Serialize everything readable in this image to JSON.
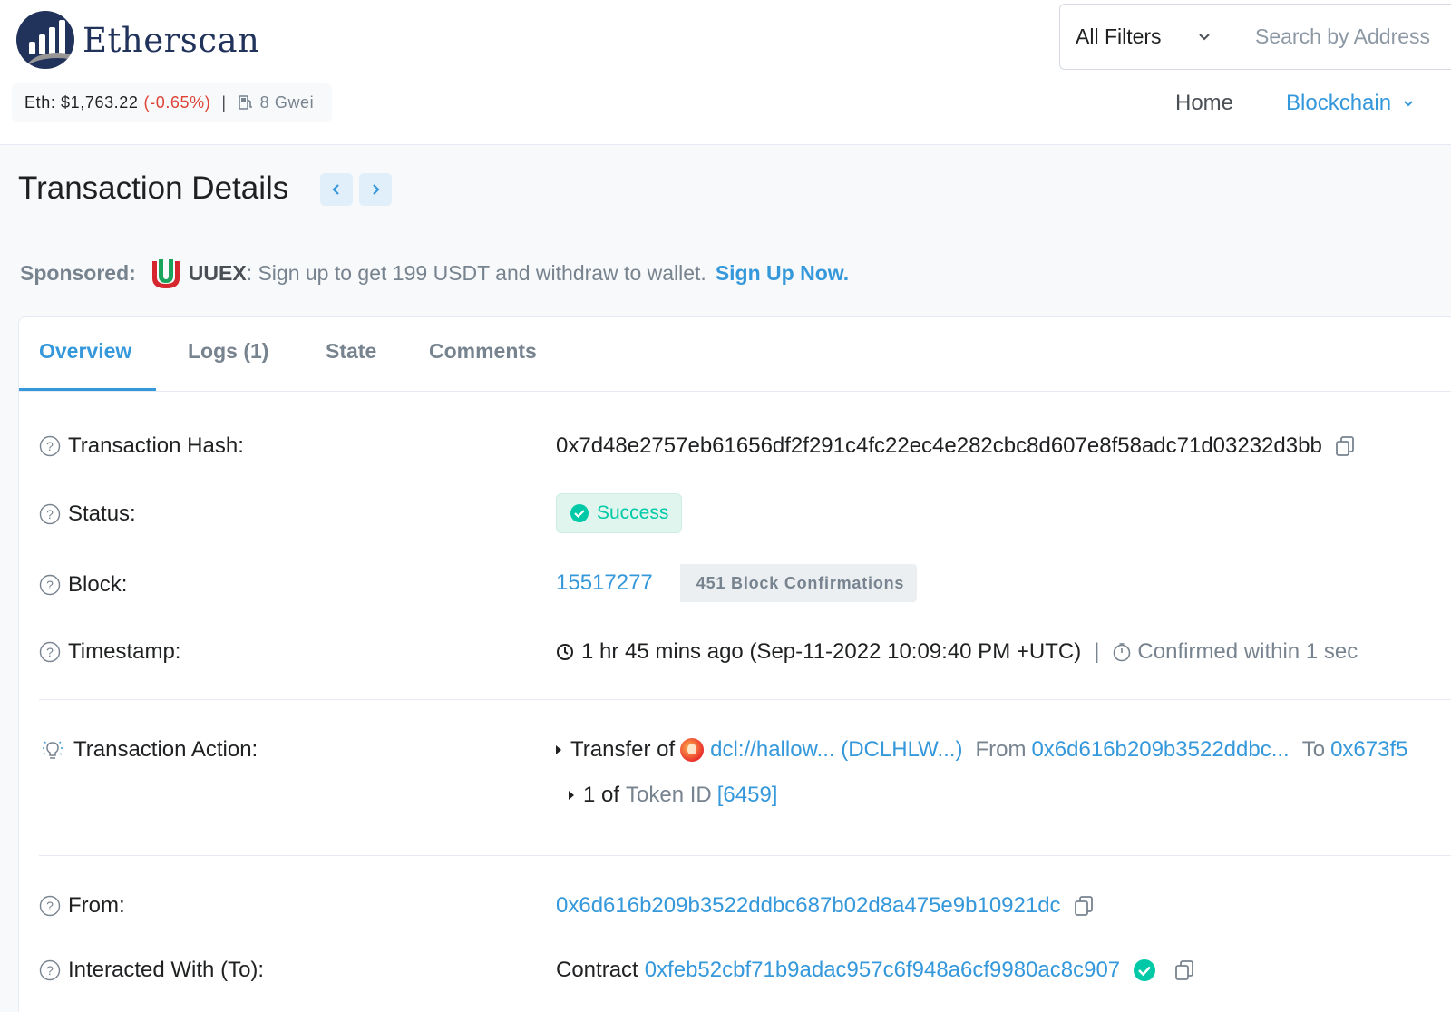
{
  "header": {
    "logo_text": "Etherscan",
    "eth_label": "Eth:",
    "eth_price": "$1,763.22",
    "eth_change": "(-0.65%)",
    "separator": "|",
    "gas": "8 Gwei",
    "filter_label": "All Filters",
    "search_placeholder": "Search by Address",
    "nav_home": "Home",
    "nav_blockchain": "Blockchain"
  },
  "page": {
    "title": "Transaction Details"
  },
  "sponsored": {
    "label": "Sponsored:",
    "brand": "UUEX",
    "message": ": Sign up to get 199 USDT and withdraw to wallet.",
    "cta": "Sign Up Now."
  },
  "tabs": [
    {
      "label": "Overview",
      "active": true
    },
    {
      "label": "Logs (1)",
      "active": false
    },
    {
      "label": "State",
      "active": false
    },
    {
      "label": "Comments",
      "active": false
    }
  ],
  "details": {
    "hash_label": "Transaction Hash:",
    "hash_value": "0x7d48e2757eb61656df2f291c4fc22ec4e282cbc8d607e8f58adc71d03232d3bb",
    "status_label": "Status:",
    "status_value": "Success",
    "block_label": "Block:",
    "block_value": "15517277",
    "block_confirmations": "451 Block Confirmations",
    "timestamp_label": "Timestamp:",
    "timestamp_value": "1 hr 45 mins ago (Sep-11-2022 10:09:40 PM +UTC)",
    "timestamp_sep": "|",
    "confirmed_within": "Confirmed within 1 sec",
    "action_label": "Transaction Action:",
    "action_transfer": "Transfer of",
    "action_token": "dcl://hallow... (DCLHLW...)",
    "action_from_label": "From",
    "action_from": "0x6d616b209b3522ddbc...",
    "action_to_label": "To",
    "action_to": "0x673f5",
    "action_qty": "1 of",
    "action_token_id_label": "Token ID",
    "action_token_id": "[6459]",
    "from_label": "From:",
    "from_value": "0x6d616b209b3522ddbc687b02d8a475e9b10921dc",
    "to_label": "Interacted With (To):",
    "to_prefix": "Contract",
    "to_value": "0xfeb52cbf71b9adac957c6f948a6cf9980ac8c907"
  },
  "colors": {
    "brand": "#21325b",
    "link": "#3498db",
    "success": "#00c9a7",
    "negative": "#de4437"
  }
}
